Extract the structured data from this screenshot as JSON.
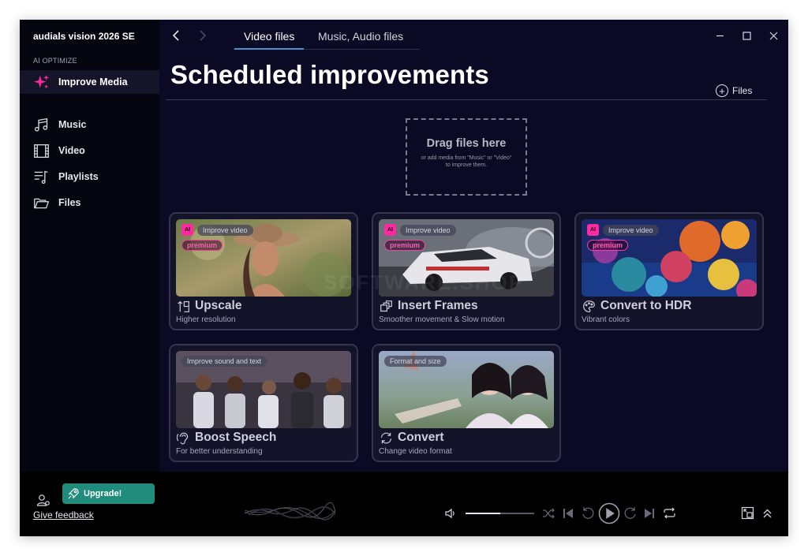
{
  "app": {
    "title": "audials vision 2026 SE",
    "section_label": "AI OPTIMIZE",
    "accent": "#ff2aa0",
    "tab_accent": "#4a90d0"
  },
  "sidebar": {
    "items": [
      {
        "label": "Improve Media",
        "icon": "sparkle-icon",
        "active": true
      },
      {
        "label": "Music",
        "icon": "music-note-icon",
        "active": false
      },
      {
        "label": "Video",
        "icon": "film-icon",
        "active": false
      },
      {
        "label": "Playlists",
        "icon": "playlist-icon",
        "active": false
      },
      {
        "label": "Files",
        "icon": "folder-icon",
        "active": false
      }
    ]
  },
  "header": {
    "tabs": [
      {
        "label": "Video files",
        "active": true
      },
      {
        "label": "Music, Audio files",
        "active": false
      }
    ],
    "page_title": "Scheduled improvements",
    "files_button": "Files"
  },
  "dropzone": {
    "title": "Drag files here",
    "subtitle": "or add media from \"Music\" or \"Video\" to improve them."
  },
  "cards": [
    {
      "tag": "Improve video",
      "ai": "AI",
      "premium": "premium",
      "title": "Upscale",
      "subtitle": "Higher resolution",
      "icon": "upscale-icon"
    },
    {
      "tag": "Improve video",
      "ai": "AI",
      "premium": "premium",
      "title": "Insert Frames",
      "subtitle": "Smoother movement & Slow motion",
      "icon": "frames-icon"
    },
    {
      "tag": "Improve video",
      "ai": "AI",
      "premium": "premium",
      "title": "Convert to HDR",
      "subtitle": "Vibrant colors",
      "icon": "palette-icon"
    },
    {
      "tag": "Improve sound and text",
      "title": "Boost Speech",
      "subtitle": "For better understanding",
      "icon": "ear-icon"
    },
    {
      "tag": "Format and size",
      "title": "Convert",
      "subtitle": "Change video format",
      "icon": "convert-icon"
    }
  ],
  "footer": {
    "upgrade_label": "Upgrade!",
    "feedback_label": "Give feedback",
    "volume_fraction": 0.5
  },
  "watermark": "SOFTWARE.SHOP"
}
